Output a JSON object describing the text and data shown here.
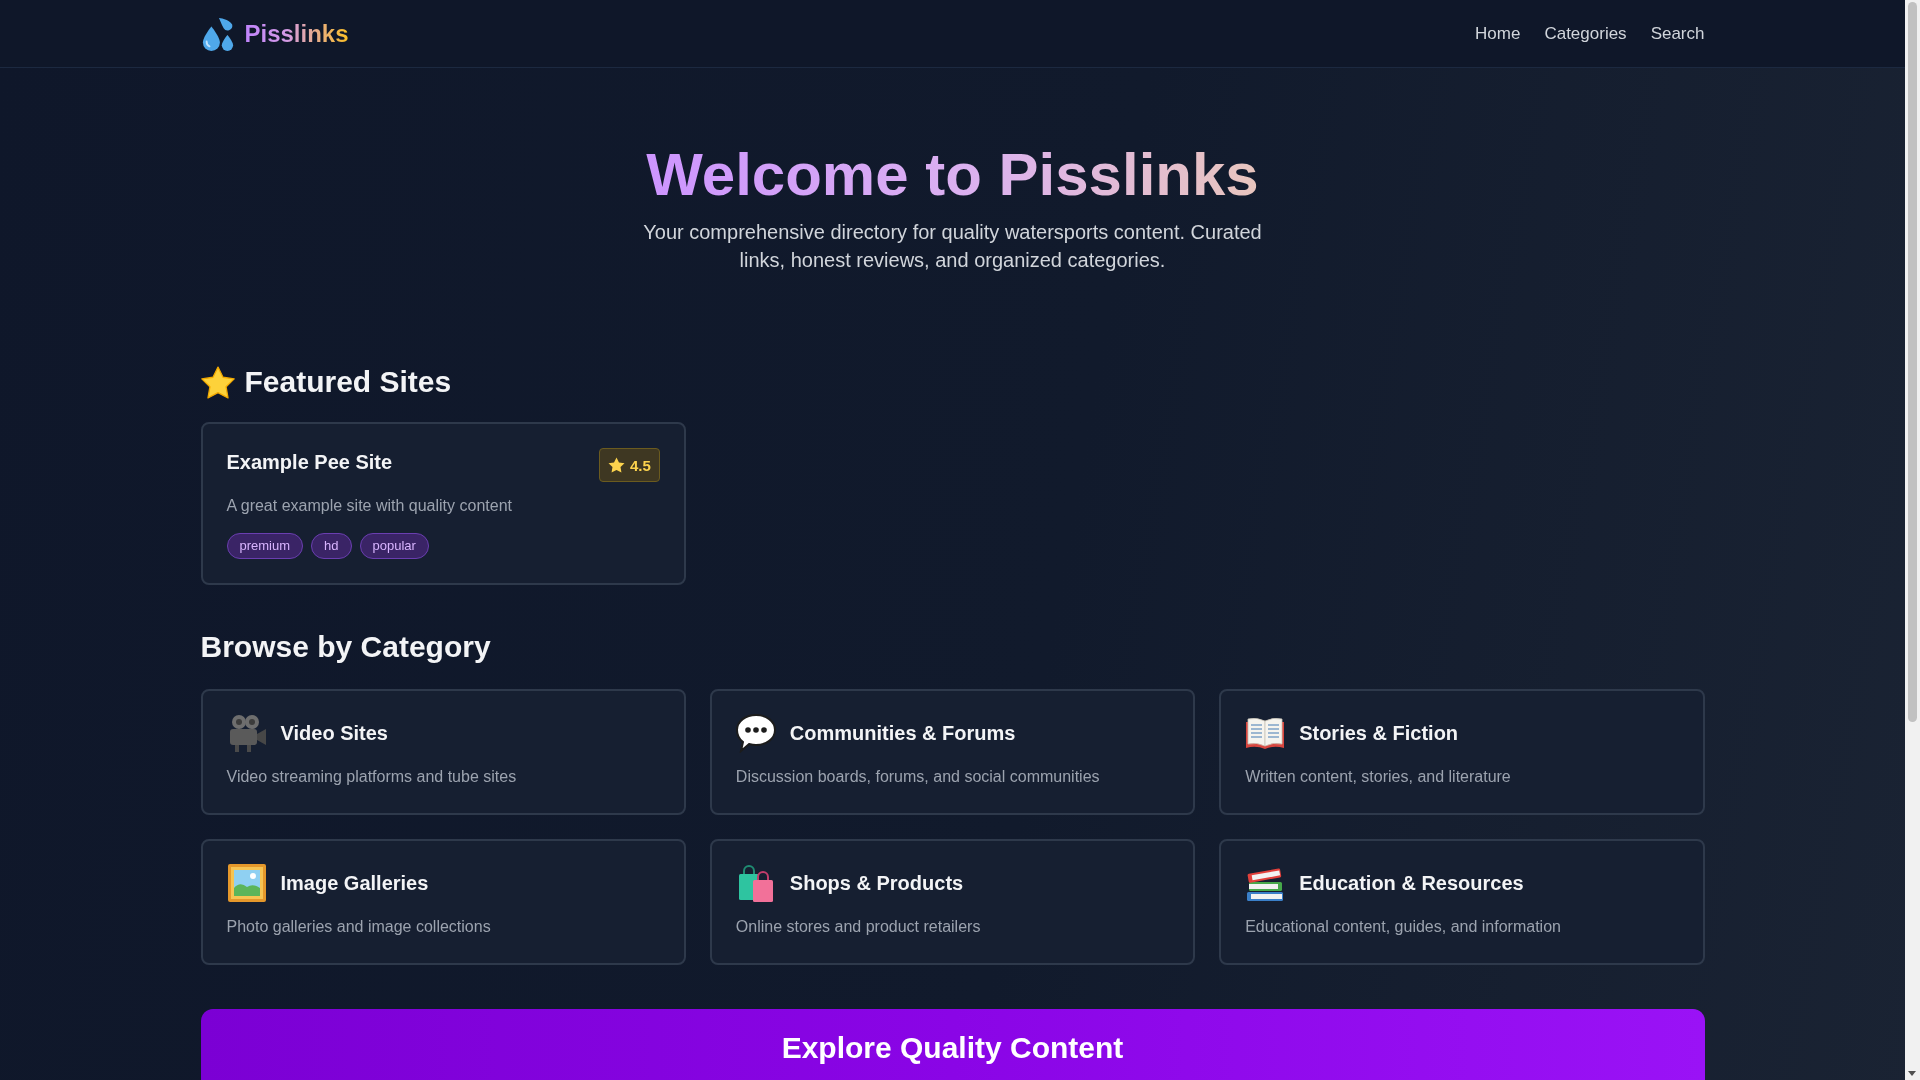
{
  "header": {
    "logo": "Pisslinks",
    "nav": [
      {
        "label": "Home"
      },
      {
        "label": "Categories"
      },
      {
        "label": "Search"
      }
    ]
  },
  "hero": {
    "title": "Welcome to Pisslinks",
    "subtitle": "Your comprehensive directory for quality watersports content. Curated links, honest reviews, and organized categories."
  },
  "featured": {
    "heading": "Featured Sites",
    "sites": [
      {
        "name": "Example Pee Site",
        "rating": "4.5",
        "description": "A great example site with quality content",
        "tags": [
          "premium",
          "hd",
          "popular"
        ]
      }
    ]
  },
  "categories": {
    "heading": "Browse by Category",
    "items": [
      {
        "title": "Video Sites",
        "description": "Video streaming platforms and tube sites"
      },
      {
        "title": "Communities & Forums",
        "description": "Discussion boards, forums, and social communities"
      },
      {
        "title": "Stories & Fiction",
        "description": "Written content, stories, and literature"
      },
      {
        "title": "Image Galleries",
        "description": "Photo galleries and image collections"
      },
      {
        "title": "Shops & Products",
        "description": "Online stores and product retailers"
      },
      {
        "title": "Education & Resources",
        "description": "Educational content, guides, and information"
      }
    ]
  },
  "banner": {
    "title": "Explore Quality Content"
  }
}
